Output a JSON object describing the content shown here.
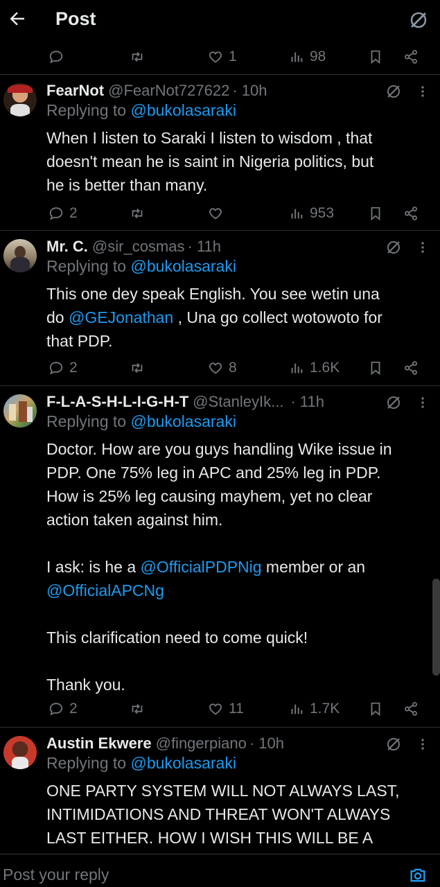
{
  "header": {
    "title": "Post"
  },
  "top_actions": {
    "likes": "1",
    "views": "98"
  },
  "tweets": [
    {
      "name": "FearNot",
      "handle": "@FearNot727622",
      "time": "· 10h",
      "replying_label": "Replying to",
      "replying_to": "@bukolasaraki",
      "text_lines": [
        "When I listen to Saraki I listen to wisdom , that",
        "doesn't mean he is saint in Nigeria politics, but",
        "he is better than many."
      ],
      "replies": "2",
      "likes": "",
      "views": "953"
    },
    {
      "name": "Mr. C.",
      "handle": "@sir_cosmas",
      "time": "· 11h",
      "replying_label": "Replying to",
      "replying_to": "@bukolasaraki",
      "line1": "This one dey speak English. You see wetin una",
      "line2_pre": "do ",
      "line2_mention": "@GEJonathan",
      "line2_post": " , Una go collect wotowoto for",
      "line3": "that PDP.",
      "replies": "2",
      "likes": "8",
      "views": "1.6K"
    },
    {
      "name": "F-L-A-S-H-L-I-G-H-T",
      "handle": "@StanleyIk...",
      "time": "· 11h",
      "replying_label": "Replying to",
      "replying_to": "@bukolasaraki",
      "para1": [
        "Doctor. How are you guys handling Wike issue in",
        "PDP. One 75% leg in APC and 25% leg in PDP.",
        "How is 25% leg causing mayhem, yet no clear",
        "action taken against him."
      ],
      "ask_pre": "I ask: is he a ",
      "ask_mention1": "@OfficialPDPNig",
      "ask_post": " member or an",
      "ask_mention2": "@OfficialAPCNg",
      "para3": "This clarification need to come quick!",
      "para4": "Thank you.",
      "replies": "2",
      "likes": "11",
      "views": "1.7K"
    },
    {
      "name": "Austin Ekwere",
      "handle": "@fingerpiano",
      "time": "· 10h",
      "replying_label": "Replying to",
      "replying_to": "@bukolasaraki",
      "text_lines": [
        "ONE PARTY SYSTEM WILL NOT ALWAYS LAST,",
        "INTIMIDATIONS AND THREAT WON'T ALWAYS",
        "LAST EITHER. HOW I WISH THIS WILL BE A"
      ]
    }
  ],
  "composer": {
    "placeholder": "Post your reply"
  },
  "colors": {
    "background": "#000000",
    "text": "#e7e9ea",
    "muted": "#71767b",
    "accent": "#1d9bf0",
    "divider": "#2f3336"
  },
  "icons": [
    "back-arrow-icon",
    "grok-icon",
    "reply-icon",
    "repost-icon",
    "like-icon",
    "views-icon",
    "bookmark-icon",
    "share-icon",
    "more-icon",
    "camera-icon"
  ]
}
